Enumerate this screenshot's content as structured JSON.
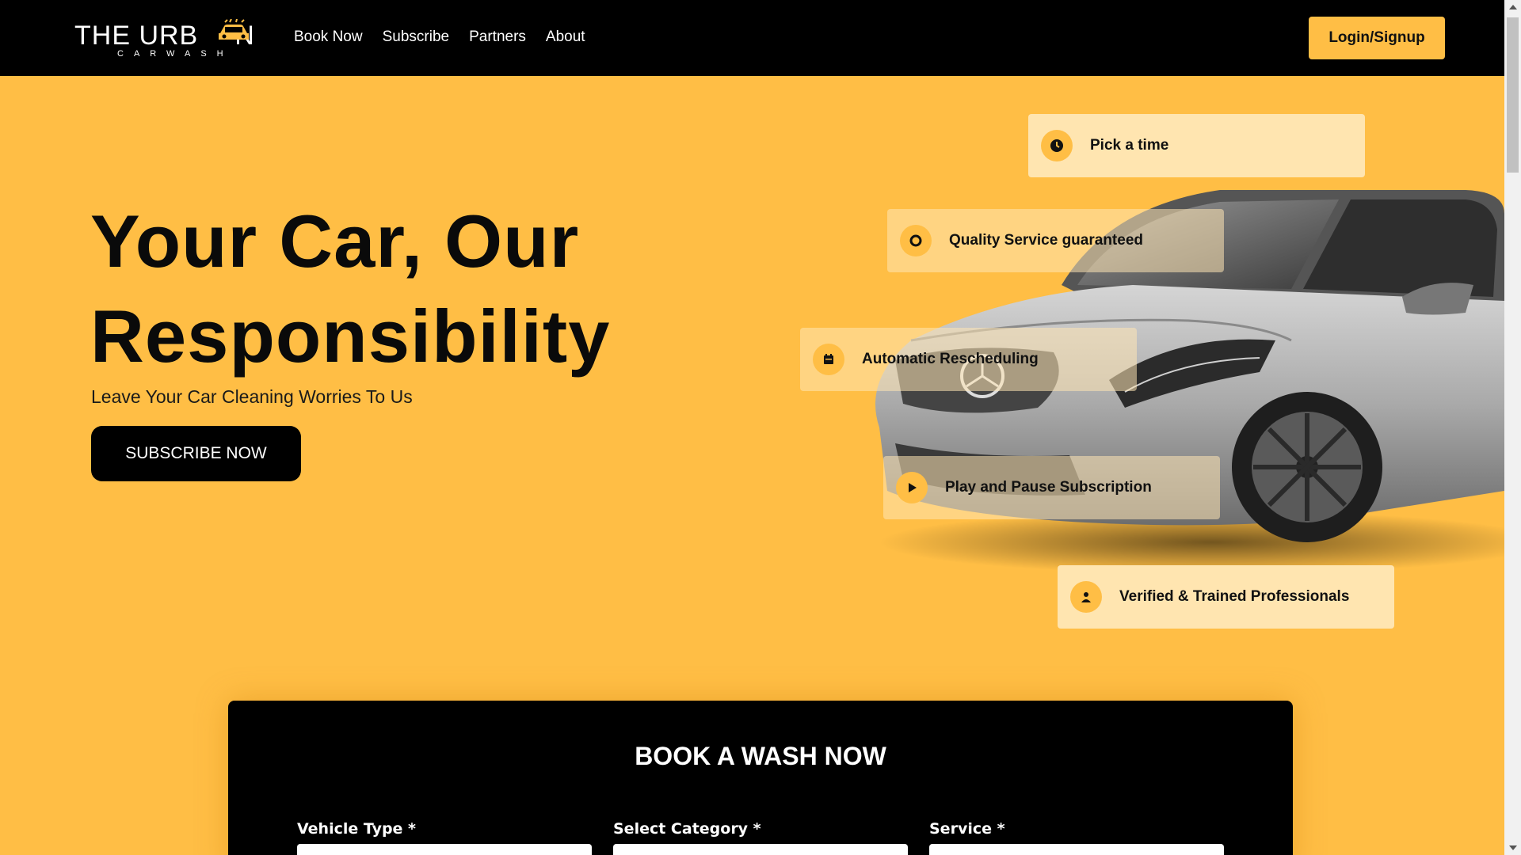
{
  "brand": {
    "name_top": "THE URB",
    "name_top_end": "N",
    "name_bottom": "CARWASH"
  },
  "nav": {
    "items": [
      "Book Now",
      "Subscribe",
      "Partners",
      "About"
    ],
    "login_label": "Login/Signup"
  },
  "hero": {
    "title_line1": "Your Car, Our",
    "title_line2": "Responsibility",
    "subtitle": "Leave Your Car Cleaning Worries To Us",
    "cta_label": "SUBSCRIBE NOW"
  },
  "features": [
    {
      "label": "Pick a time",
      "icon": "clock-icon"
    },
    {
      "label": "Quality Service guaranteed",
      "icon": "quality-badge-icon"
    },
    {
      "label": "Automatic Rescheduling",
      "icon": "calendar-icon"
    },
    {
      "label": "Play and Pause Subscription",
      "icon": "play-icon"
    },
    {
      "label": "Verified & Trained Professionals",
      "icon": "person-icon"
    }
  ],
  "booking": {
    "title": "BOOK A WASH NOW",
    "fields": [
      {
        "label": "Vehicle Type *"
      },
      {
        "label": "Select Category *"
      },
      {
        "label": "Service *"
      }
    ]
  },
  "colors": {
    "accent": "#ffbe45",
    "nav_bg": "#000000",
    "feature_bg": "#ffe5b0"
  }
}
